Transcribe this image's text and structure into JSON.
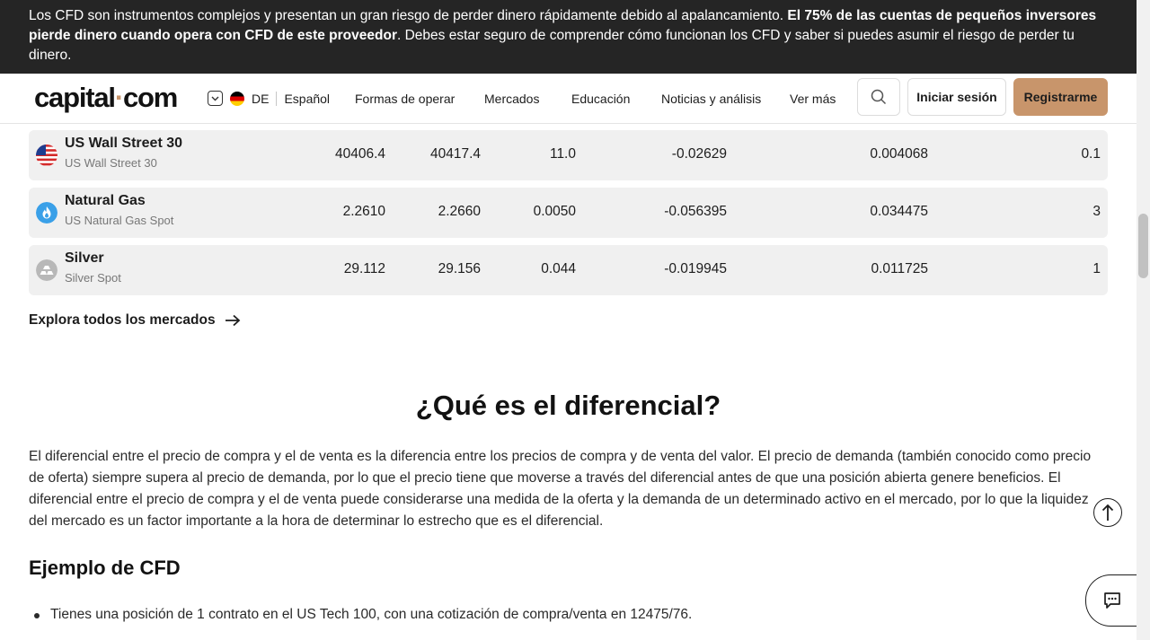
{
  "risk_banner": {
    "text_1": "Los CFD son instrumentos complejos y presentan un gran riesgo de perder dinero rápidamente debido al apalancamiento. ",
    "bold": "El 75% de las cuentas de pequeños inversores pierde dinero cuando opera con CFD de este proveedor",
    "text_2": ". Debes estar seguro de comprender cómo funcionan los CFD y saber si puedes asumir el riesgo de perder tu dinero."
  },
  "header": {
    "logo_part1": "capital",
    "logo_dot": "·",
    "logo_part2": "com",
    "country_code": "DE",
    "language": "Español",
    "nav": [
      "Formas de operar",
      "Mercados",
      "Educación",
      "Noticias y análisis",
      "Ver más"
    ],
    "login_label": "Iniciar sesión",
    "register_label": "Registrarme"
  },
  "markets": [
    {
      "name": "US Wall Street 30",
      "sub": "US Wall Street 30",
      "icon": "us-flag-icon",
      "sell": "40406.4",
      "buy": "40417.4",
      "spread": "11.0",
      "long_fee": "-0.02629",
      "short_fee": "0.004068",
      "min": "0.1"
    },
    {
      "name": "Natural Gas",
      "sub": "US Natural Gas Spot",
      "icon": "gas-flame-icon",
      "sell": "2.2610",
      "buy": "2.2660",
      "spread": "0.0050",
      "long_fee": "-0.056395",
      "short_fee": "0.034475",
      "min": "3"
    },
    {
      "name": "Silver",
      "sub": "Silver Spot",
      "icon": "silver-bars-icon",
      "sell": "29.112",
      "buy": "29.156",
      "spread": "0.044",
      "long_fee": "-0.019945",
      "short_fee": "0.011725",
      "min": "1"
    }
  ],
  "explore_label": "Explora todos los mercados",
  "section": {
    "title": "¿Qué es el diferencial?",
    "paragraph": "El diferencial entre el precio de compra y el de venta es la diferencia entre los precios de compra y de venta del valor. El precio de demanda (también conocido como precio de oferta) siempre supera al precio de demanda, por lo que el precio tiene que moverse a través del diferencial antes de que una posición abierta genere beneficios. El diferencial entre el precio de compra y el de venta puede considerarse una medida de la oferta y la demanda de un determinado activo en el mercado, por lo que la liquidez del mercado es un factor importante a la hora de determinar lo estrecho que es el diferencial.",
    "subtitle": "Ejemplo de CFD",
    "bullet_1": "Tienes una posición de 1 contrato en el US Tech 100, con una cotización de compra/venta en 12475/76."
  },
  "colors": {
    "accent": "#c8956b",
    "banner_bg": "#252525",
    "row_bg": "#f0f0f0"
  }
}
